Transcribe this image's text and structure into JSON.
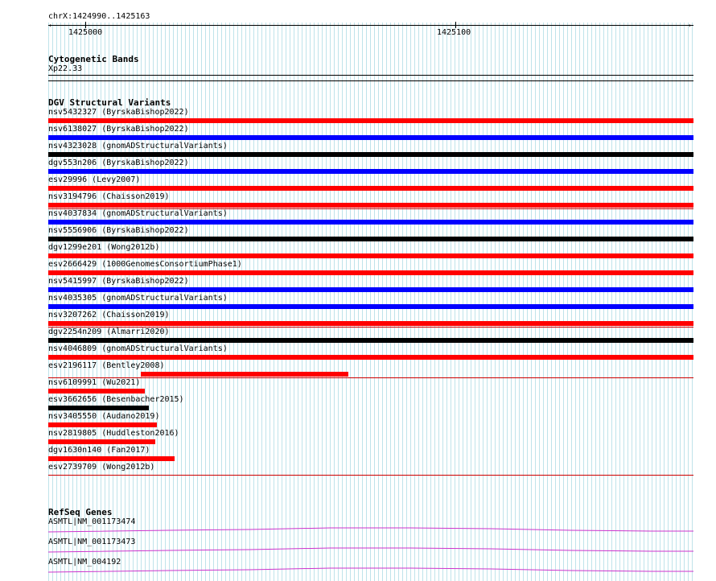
{
  "ruler": {
    "region_label": "chrX:1424990..1425163",
    "tick_labels": [
      "1425000",
      "1425100"
    ]
  },
  "cytobands": {
    "title": "Cytogenetic Bands",
    "band": "Xp22.33"
  },
  "dgv": {
    "title": "DGV Structural Variants",
    "variants": [
      {
        "label": "nsv5432327 (ByrskaBishop2022)",
        "color": "#ff0000"
      },
      {
        "label": "nsv6138027 (ByrskaBishop2022)",
        "color": "#0000ff"
      },
      {
        "label": "nsv4323028 (gnomADStructuralVariants)",
        "color": "#000000"
      },
      {
        "label": "dgv553n206 (ByrskaBishop2022)",
        "color": "#0000ff"
      },
      {
        "label": "esv29996 (Levy2007)",
        "color": "#ff0000"
      },
      {
        "label": "nsv3194796 (Chaisson2019)",
        "color": "#ff0000"
      },
      {
        "label": "nsv4037834 (gnomADStructuralVariants)",
        "color": "#0000ff"
      },
      {
        "label": "nsv5556906 (ByrskaBishop2022)",
        "color": "#000000"
      },
      {
        "label": "dgv1299e201 (Wong2012b)",
        "color": "#ff0000"
      },
      {
        "label": "esv2666429 (1000GenomesConsortiumPhase1)",
        "color": "#ff0000"
      },
      {
        "label": "nsv5415997 (ByrskaBishop2022)",
        "color": "#0000ff"
      },
      {
        "label": "nsv4035305 (gnomADStructuralVariants)",
        "color": "#0000ff"
      },
      {
        "label": "nsv3207262 (Chaisson2019)",
        "color": "#ff0000"
      },
      {
        "label": "dgv2254n209 (Almarri2020)",
        "color": "#000000"
      },
      {
        "label": "nsv4046809 (gnomADStructuralVariants)",
        "color": "#ff0000"
      },
      {
        "label": "esv2196117 (Bentley2008)",
        "color": "#ff0000"
      },
      {
        "label": "nsv6109991 (Wu2021)",
        "color": "#ff0000"
      },
      {
        "label": "esv3662656 (Besenbacher2015)",
        "color": "#000000"
      },
      {
        "label": "nsv3405550 (Audano2019)",
        "color": "#ff0000"
      },
      {
        "label": "nsv2819805 (Huddleston2016)",
        "color": "#ff0000"
      },
      {
        "label": "dgv1630n140 (Fan2017)",
        "color": "#ff0000"
      },
      {
        "label": "esv2739709 (Wong2012b)",
        "color": "#ff0000"
      }
    ]
  },
  "refseq": {
    "title": "RefSeq Genes",
    "transcripts": [
      {
        "label": "ASMTL|NM_001173474"
      },
      {
        "label": "ASMTL|NM_001173473"
      },
      {
        "label": "ASMTL|NM_004192"
      }
    ],
    "color": "#cc33cc"
  },
  "colors": {
    "grid": "#bfe3ea",
    "ruler": "#000000"
  }
}
